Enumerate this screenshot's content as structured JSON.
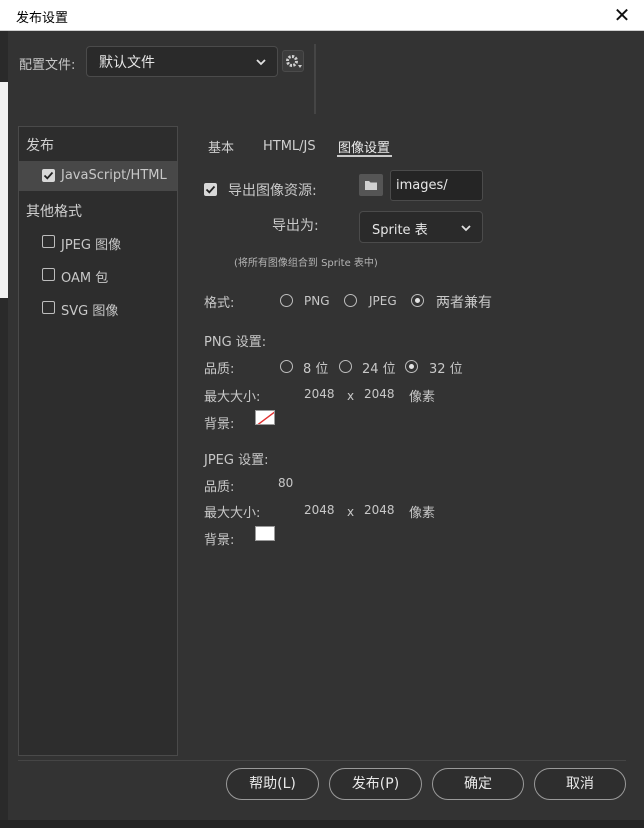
{
  "window": {
    "title": "发布设置",
    "close_glyph": "✕"
  },
  "profile": {
    "label": "配置文件:",
    "selected": "默认文件",
    "gear_icon": "gear-icon"
  },
  "categories": {
    "publish_heading": "发布",
    "other_heading": "其他格式",
    "items": [
      {
        "label": "JavaScript/HTML",
        "checked": true,
        "selected": true
      },
      {
        "label": "JPEG 图像",
        "checked": false,
        "selected": false
      },
      {
        "label": "OAM 包",
        "checked": false,
        "selected": false
      },
      {
        "label": "SVG 图像",
        "checked": false,
        "selected": false
      }
    ]
  },
  "tabs": [
    {
      "label": "基本",
      "active": false
    },
    {
      "label": "HTML/JS",
      "active": false
    },
    {
      "label": "图像设置",
      "active": true
    }
  ],
  "export": {
    "checkbox_label": "导出图像资源:",
    "checked": true,
    "path": "images/",
    "export_as_label": "导出为:",
    "export_as_value": "Sprite 表",
    "hint": "(将所有图像组合到 Sprite 表中)"
  },
  "format": {
    "label": "格式:",
    "options": [
      "PNG",
      "JPEG",
      "两者兼有"
    ],
    "selected": "两者兼有"
  },
  "png": {
    "heading": "PNG 设置:",
    "quality_label": "品质:",
    "quality_options": [
      "8 位",
      "24 位",
      "32 位"
    ],
    "quality_selected": "32 位",
    "maxsize_label": "最大大小:",
    "width": "2048",
    "times": "x",
    "height": "2048",
    "unit": "像素",
    "bg_label": "背景:"
  },
  "jpeg": {
    "heading": "JPEG 设置:",
    "quality_label": "品质:",
    "quality_value": "80",
    "maxsize_label": "最大大小:",
    "width": "2048",
    "times": "x",
    "height": "2048",
    "unit": "像素",
    "bg_label": "背景:"
  },
  "buttons": {
    "help": "帮助(L)",
    "publish": "发布(P)",
    "ok": "确定",
    "cancel": "取消"
  },
  "colors": {
    "panel": "#333333",
    "accent_check": "#d8d8d8",
    "png_bg": "#ffffff",
    "jpeg_bg": "#ffffff"
  }
}
